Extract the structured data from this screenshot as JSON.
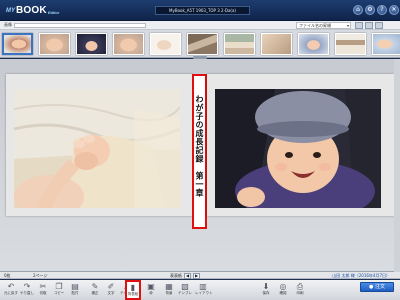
{
  "app": {
    "logo": {
      "my": "MY",
      "book": "BOOK",
      "editor": "Editor"
    },
    "doc_title": "MyBook_A5T 1903_TOP 3 2·Da(a)",
    "window_buttons": [
      {
        "name": "home-icon",
        "glyph": "⌂"
      },
      {
        "name": "settings-icon",
        "glyph": "⚙"
      },
      {
        "name": "help-icon",
        "glyph": "?"
      },
      {
        "name": "close-icon",
        "glyph": "✕"
      }
    ]
  },
  "strip": {
    "label": "画像",
    "sort_select": "ファイル名の昇順",
    "thumbnails": [
      "t-baby",
      "t-face",
      "t-dark",
      "t-face",
      "t-light",
      "t-room",
      "t-green",
      "t-beige",
      "t-blue",
      "t-shelf",
      "t-baby2"
    ]
  },
  "spread": {
    "spine_title": "わが子の成長記録　第一章"
  },
  "status": {
    "left1": "0枚",
    "left2": "2ページ",
    "center": "表表紙",
    "right": "山田 太郎 様（2016年4月7日）"
  },
  "toolbar": {
    "tools": [
      {
        "name": "undo",
        "icon": "↶",
        "label": "元に戻す"
      },
      {
        "name": "redo",
        "icon": "↷",
        "label": "やり直し"
      },
      {
        "name": "cut",
        "icon": "✂",
        "label": "切取"
      },
      {
        "name": "copy",
        "icon": "❐",
        "label": "コピー"
      },
      {
        "name": "paste",
        "icon": "▤",
        "label": "貼付"
      },
      {
        "name": "brush",
        "icon": "✎",
        "label": "補正"
      },
      {
        "name": "pen",
        "icon": "✐",
        "label": "文字"
      },
      {
        "name": "text",
        "icon": "A",
        "label": "テキスト"
      },
      {
        "name": "spine",
        "icon": "▮",
        "label": "背表紙"
      },
      {
        "name": "frame",
        "icon": "▣",
        "label": "枠"
      },
      {
        "name": "background",
        "icon": "▦",
        "label": "背景"
      },
      {
        "name": "template",
        "icon": "▧",
        "label": "テンプレ"
      },
      {
        "name": "layout",
        "icon": "▥",
        "label": "レイアウト"
      },
      {
        "name": "save",
        "icon": "⬇",
        "label": "保存"
      },
      {
        "name": "preview",
        "icon": "◎",
        "label": "確認"
      },
      {
        "name": "print",
        "icon": "⎙",
        "label": "印刷"
      }
    ],
    "order_button": "● 注文"
  }
}
